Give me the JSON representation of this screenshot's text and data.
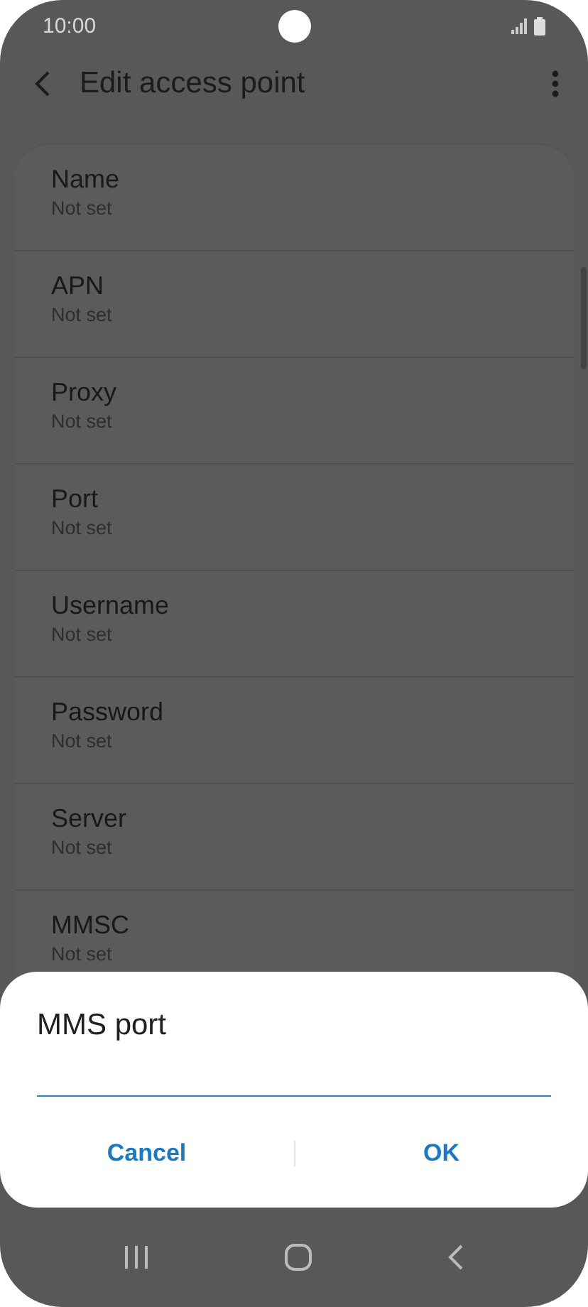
{
  "status_bar": {
    "time": "10:00"
  },
  "app_bar": {
    "title": "Edit access point"
  },
  "settings": [
    {
      "label": "Name",
      "value": "Not set"
    },
    {
      "label": "APN",
      "value": "Not set"
    },
    {
      "label": "Proxy",
      "value": "Not set"
    },
    {
      "label": "Port",
      "value": "Not set"
    },
    {
      "label": "Username",
      "value": "Not set"
    },
    {
      "label": "Password",
      "value": "Not set"
    },
    {
      "label": "Server",
      "value": "Not set"
    },
    {
      "label": "MMSC",
      "value": "Not set"
    }
  ],
  "dialog": {
    "title": "MMS port",
    "buttons": [
      "Cancel",
      "OK"
    ]
  }
}
